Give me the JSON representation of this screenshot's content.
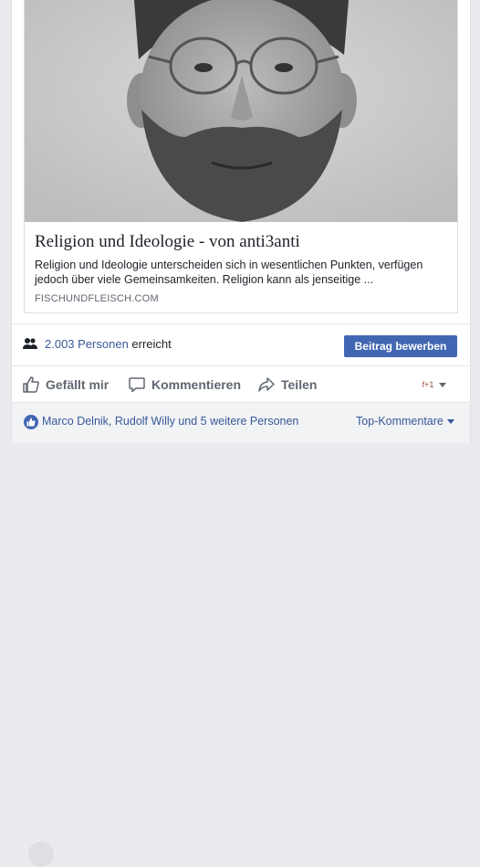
{
  "link_preview": {
    "title": "Religion und Ideologie - von anti3anti",
    "description": "Religion und Ideologie unterscheiden sich in wesentlichen Punkten, verfügen jedoch über viele Gemeinsamkeiten. Religion kann als jenseitige ...",
    "domain": "FISCHUNDFLEISCH.COM",
    "image": "photo of bearded man with glasses (grayscale)"
  },
  "reach": {
    "icon": "people-icon",
    "count": "2.003 Personen",
    "suffix": "erreicht",
    "promote_label": "Beitrag bewerben"
  },
  "actions": {
    "like_label": "Gefällt mir",
    "comment_label": "Kommentieren",
    "share_label": "Teilen",
    "reactor_avatar": "f+1"
  },
  "reactions": {
    "text": "Marco Delnik, Rudolf Willy und 5 weitere Personen",
    "sort_label": "Top-Kommentare"
  },
  "colors": {
    "accent": "#4267b2",
    "link": "#385898",
    "muted": "#606770"
  }
}
